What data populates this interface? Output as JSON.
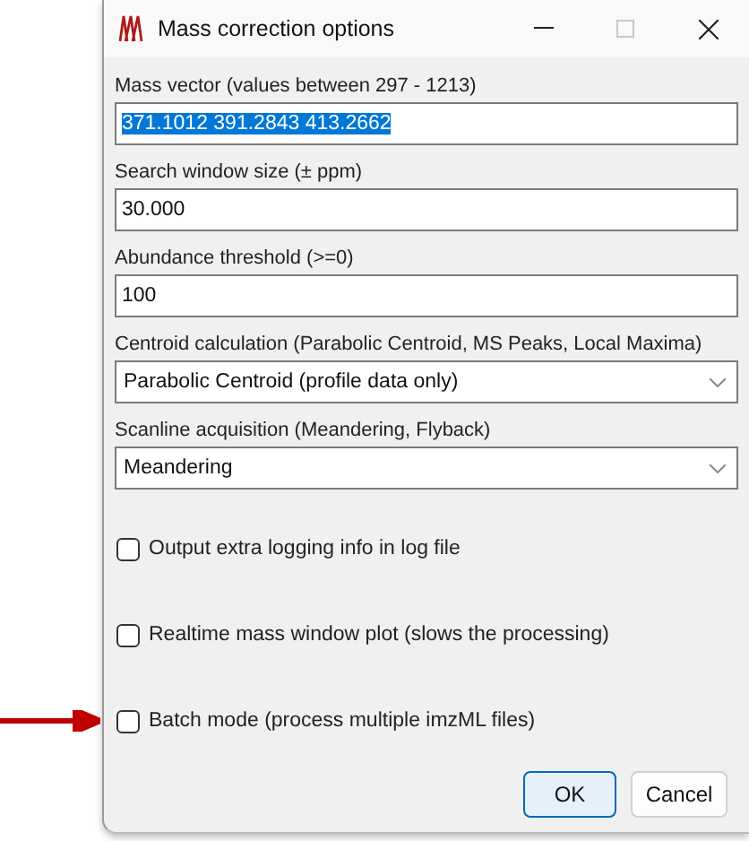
{
  "window": {
    "title": "Mass correction options",
    "controls": [
      {
        "kind": "minimize",
        "disabled": false
      },
      {
        "kind": "maximize",
        "disabled": true
      },
      {
        "kind": "close",
        "disabled": false
      }
    ]
  },
  "fields": [
    {
      "kind": "text",
      "label": "Mass vector (values between 297 - 1213)",
      "value": "371.1012 391.2843 413.2662",
      "selected": true
    },
    {
      "kind": "text",
      "label": "Search window size (± ppm)",
      "value": "30.000"
    },
    {
      "kind": "text",
      "label": "Abundance threshold (>=0)",
      "value": "100"
    },
    {
      "kind": "dropdown",
      "label": "Centroid calculation (Parabolic Centroid, MS Peaks, Local Maxima)",
      "value": "Parabolic Centroid (profile data only)"
    },
    {
      "kind": "dropdown",
      "label": "Scanline acquisition (Meandering, Flyback)",
      "value": "Meandering"
    }
  ],
  "checkboxes": [
    {
      "label": "Output extra logging info in log file",
      "checked": false,
      "pointed": false
    },
    {
      "label": "Realtime mass window plot (slows the processing)",
      "checked": false,
      "pointed": false
    },
    {
      "label": "Batch mode (process multiple imzML files)",
      "checked": false,
      "pointed": true
    }
  ],
  "buttons": [
    {
      "label": "OK",
      "default": true
    },
    {
      "label": "Cancel",
      "default": false
    }
  ]
}
